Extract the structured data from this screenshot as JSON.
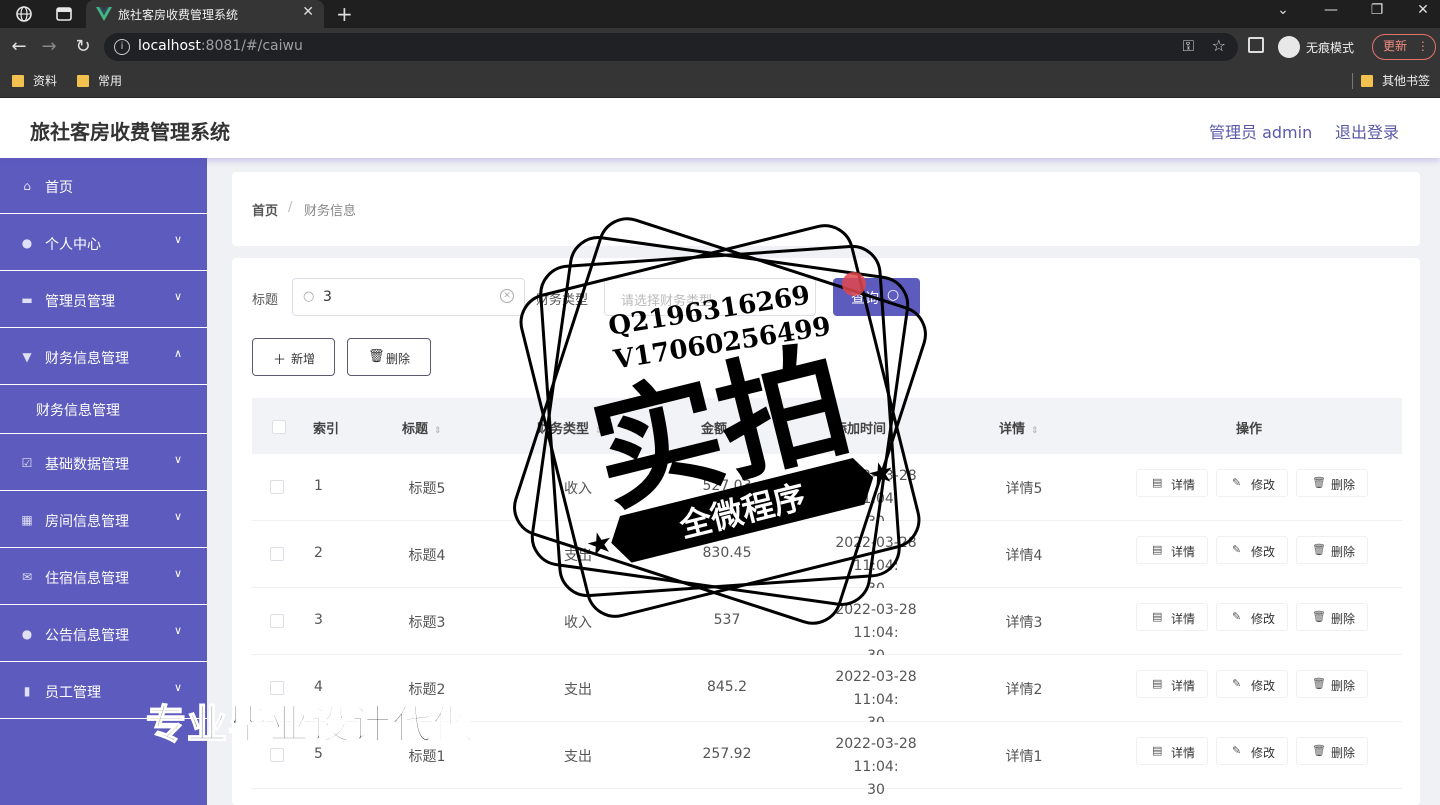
{
  "browser": {
    "tab_title": "旅社客房收费管理系统",
    "url_host": "localhost",
    "url_rest": ":8081/#/caiwu",
    "incognito_label": "无痕模式",
    "update_label": "更新",
    "bookmarks": [
      "资料",
      "常用"
    ],
    "other_bookmarks": "其他书签"
  },
  "app": {
    "title": "旅社客房收费管理系统",
    "user_label": "管理员 admin",
    "logout_label": "退出登录"
  },
  "sidebar": {
    "items": [
      {
        "label": "首页",
        "icon": "home-icon"
      },
      {
        "label": "个人中心",
        "icon": "user-icon"
      },
      {
        "label": "管理员管理",
        "icon": "archive-icon"
      },
      {
        "label": "财务信息管理",
        "icon": "pin-icon",
        "expanded": true
      },
      {
        "label": "基础数据管理",
        "icon": "checklist-icon"
      },
      {
        "label": "房间信息管理",
        "icon": "grid-icon"
      },
      {
        "label": "住宿信息管理",
        "icon": "mail-icon"
      },
      {
        "label": "公告信息管理",
        "icon": "user-icon"
      },
      {
        "label": "员工管理",
        "icon": "bar-chart-icon"
      }
    ],
    "sub_item": "财务信息管理"
  },
  "breadcrumb": {
    "home": "首页",
    "separator": "/",
    "current": "财务信息"
  },
  "filters": {
    "title_label": "标题",
    "title_value": "3",
    "type_label": "财务类型",
    "type_placeholder": "请选择财务类型",
    "query_label": "查询"
  },
  "toolbar": {
    "add_label": "新增",
    "delete_label": "删除"
  },
  "table": {
    "headers": {
      "index": "索引",
      "title": "标题",
      "type": "财务类型",
      "amount": "金额",
      "time": "添加时间",
      "detail": "详情",
      "actions": "操作"
    },
    "action_labels": {
      "detail": "详情",
      "edit": "修改",
      "delete": "删除"
    },
    "rows": [
      {
        "index": "1",
        "title": "标题5",
        "type": "收入",
        "amount": "527.03",
        "time_a": "2022-03-28 11:04:",
        "time_b": "30",
        "detail": "详情5"
      },
      {
        "index": "2",
        "title": "标题4",
        "type": "支出",
        "amount": "830.45",
        "time_a": "2022-03-28 11:04:",
        "time_b": "30",
        "detail": "详情4"
      },
      {
        "index": "3",
        "title": "标题3",
        "type": "收入",
        "amount": "537",
        "time_a": "2022-03-28 11:04:",
        "time_b": "30",
        "detail": "详情3"
      },
      {
        "index": "4",
        "title": "标题2",
        "type": "支出",
        "amount": "845.2",
        "time_a": "2022-03-28 11:04:",
        "time_b": "30",
        "detail": "详情2"
      },
      {
        "index": "5",
        "title": "标题1",
        "type": "支出",
        "amount": "257.92",
        "time_a": "2022-03-28 11:04:",
        "time_b": "30",
        "detail": "详情1"
      }
    ]
  },
  "watermark": {
    "qq": "Q2196316269",
    "vx": "V17060256499",
    "big": "实拍",
    "ribbon": "全微程序",
    "bottom": "专业毕业设计代做"
  },
  "colors": {
    "primary": "#5d5bbd",
    "header_text": "#5a59a8"
  }
}
